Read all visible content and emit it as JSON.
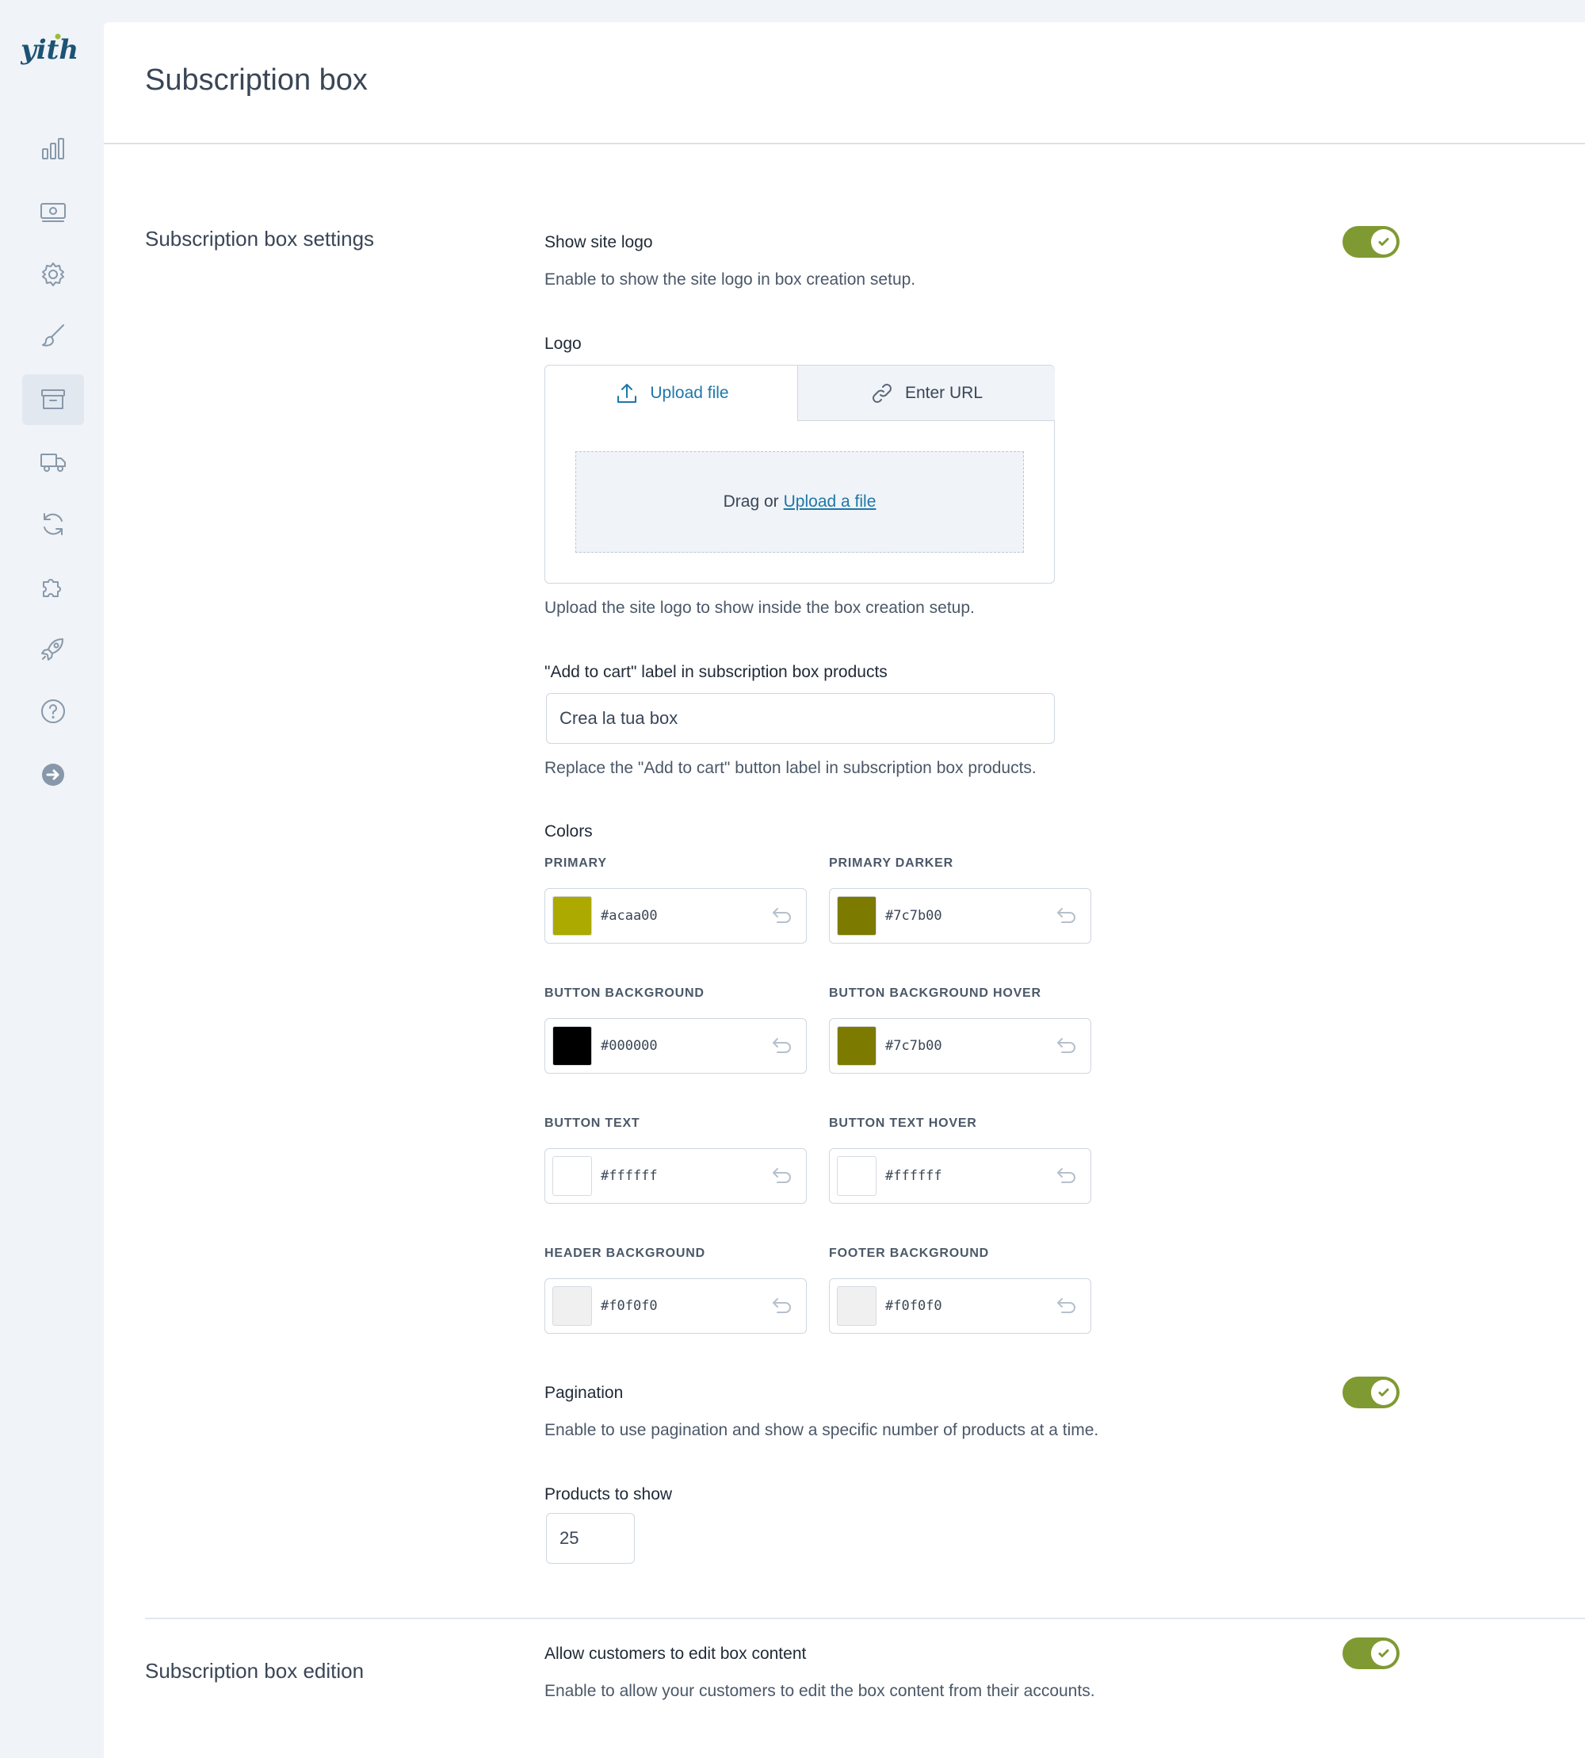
{
  "app": {
    "logo_text": "yith"
  },
  "sidebar": {
    "icons": [
      "bar-chart-icon",
      "money-icon",
      "gear-icon",
      "brush-icon",
      "archive-box-icon",
      "truck-icon",
      "refresh-icon",
      "puzzle-icon",
      "rocket-icon",
      "help-icon",
      "arrow-right-circle-icon"
    ],
    "active_icon": "archive-box-icon"
  },
  "page": {
    "title": "Subscription box"
  },
  "settings": {
    "section_title": "Subscription box settings",
    "show_site_logo": {
      "title": "Show site logo",
      "description": "Enable to show the site logo in box creation setup.",
      "enabled": true
    },
    "logo": {
      "title": "Logo",
      "tab_upload": "Upload file",
      "tab_url": "Enter URL",
      "drag_text": "Drag or",
      "upload_link": "Upload a file",
      "description": "Upload the site logo to show inside the box creation setup."
    },
    "add_to_cart": {
      "title": "\"Add to cart\" label in subscription box products",
      "value": "Crea la tua box",
      "description": "Replace the \"Add to cart\" button label in subscription box products."
    },
    "colors": {
      "title": "Colors",
      "items": [
        {
          "label": "PRIMARY",
          "hex": "#acaa00"
        },
        {
          "label": "PRIMARY DARKER",
          "hex": "#7c7b00"
        },
        {
          "label": "BUTTON BACKGROUND",
          "hex": "#000000"
        },
        {
          "label": "BUTTON BACKGROUND HOVER",
          "hex": "#7c7b00"
        },
        {
          "label": "BUTTON TEXT",
          "hex": "#ffffff"
        },
        {
          "label": "BUTTON TEXT HOVER",
          "hex": "#ffffff"
        },
        {
          "label": "HEADER BACKGROUND",
          "hex": "#f0f0f0"
        },
        {
          "label": "FOOTER BACKGROUND",
          "hex": "#f0f0f0"
        }
      ]
    },
    "pagination": {
      "title": "Pagination",
      "description": "Enable to use pagination and show a specific number of products at a time.",
      "enabled": true
    },
    "products_to_show": {
      "title": "Products to show",
      "value": "25"
    }
  },
  "edition": {
    "section_title": "Subscription box edition",
    "allow_edit": {
      "title": "Allow customers to edit box content",
      "description": "Enable to allow your customers to edit the box content from their accounts.",
      "enabled": true
    }
  },
  "theme": {
    "accent": "#7f9a32",
    "link": "#1d78a8"
  }
}
